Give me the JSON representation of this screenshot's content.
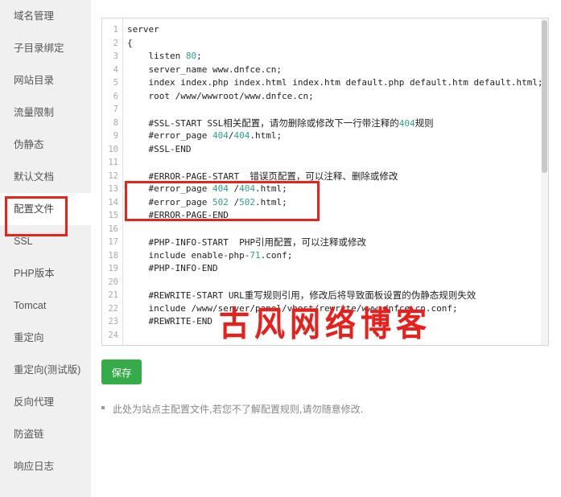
{
  "sidebar": {
    "items": [
      {
        "label": "域名管理",
        "active": false
      },
      {
        "label": "子目录绑定",
        "active": false
      },
      {
        "label": "网站目录",
        "active": false
      },
      {
        "label": "流量限制",
        "active": false
      },
      {
        "label": "伪静态",
        "active": false
      },
      {
        "label": "默认文档",
        "active": false
      },
      {
        "label": "配置文件",
        "active": true
      },
      {
        "label": "SSL",
        "active": false
      },
      {
        "label": "PHP版本",
        "active": false
      },
      {
        "label": "Tomcat",
        "active": false
      },
      {
        "label": "重定向",
        "active": false
      },
      {
        "label": "重定向(测试版)",
        "active": false
      },
      {
        "label": "反向代理",
        "active": false
      },
      {
        "label": "防盗链",
        "active": false
      },
      {
        "label": "响应日志",
        "active": false
      }
    ]
  },
  "editor": {
    "line_numbers": [
      1,
      2,
      3,
      4,
      5,
      6,
      7,
      8,
      9,
      10,
      11,
      12,
      13,
      14,
      15,
      16,
      17,
      18,
      19,
      20,
      21,
      22,
      23,
      24
    ],
    "lines": [
      "server",
      "{",
      "    listen 80;",
      "    server_name www.dnfce.cn;",
      "    index index.php index.html index.htm default.php default.htm default.html;",
      "    root /www/wwwroot/www.dnfce.cn;",
      "",
      "    #SSL-START SSL相关配置，请勿删除或修改下一行带注释的404规则",
      "    #error_page 404/404.html;",
      "    #SSL-END",
      "",
      "    #ERROR-PAGE-START  错误页配置，可以注释、删除或修改",
      "    #error_page 404 /404.html;",
      "    #error_page 502 /502.html;",
      "    #ERROR-PAGE-END",
      "",
      "    #PHP-INFO-START  PHP引用配置，可以注释或修改",
      "    include enable-php-71.conf;",
      "    #PHP-INFO-END",
      "",
      "    #REWRITE-START URL重写规则引用，修改后将导致面板设置的伪静态规则失效",
      "    include /www/server/panel/vhost/rewrite/www.dnfce.cn.conf;",
      "    #REWRITE-END",
      ""
    ],
    "watermark": "古风网络博客"
  },
  "actions": {
    "save_label": "保存"
  },
  "footer": {
    "note": "此处为站点主配置文件,若您不了解配置规则,请勿随意修改."
  },
  "colors": {
    "accent_green": "#36ab4a",
    "annotation_red": "#e8241a",
    "sidebar_bg": "#f0f0f0",
    "number_token": "#2f9e8f",
    "watermark_red": "#e8201b"
  }
}
